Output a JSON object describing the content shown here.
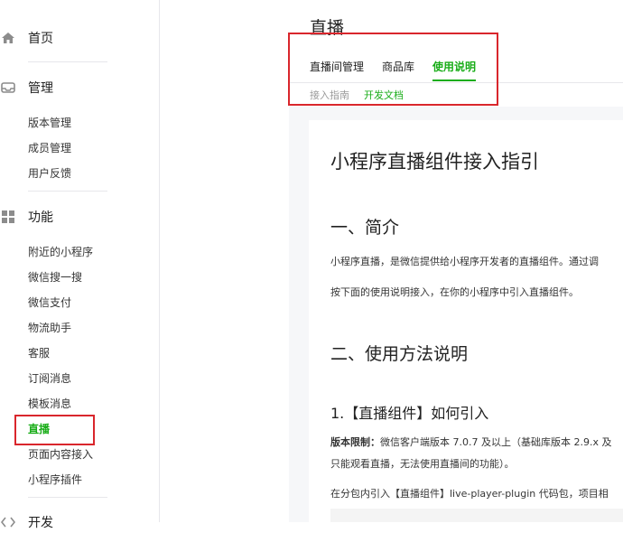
{
  "sidebar": {
    "home": {
      "label": "首页",
      "icon": "home-icon"
    },
    "manage": {
      "label": "管理",
      "icon": "inbox-icon",
      "items": [
        "版本管理",
        "成员管理",
        "用户反馈"
      ]
    },
    "features": {
      "label": "功能",
      "icon": "grid-icon",
      "items": [
        "附近的小程序",
        "微信搜一搜",
        "微信支付",
        "物流助手",
        "客服",
        "订阅消息",
        "模板消息",
        "直播",
        "页面内容接入",
        "小程序插件"
      ],
      "active_index": 7
    },
    "dev": {
      "label": "开发",
      "icon": "code-icon"
    }
  },
  "page": {
    "title": "直播",
    "tabs": [
      "直播间管理",
      "商品库",
      "使用说明"
    ],
    "active_tab": 2,
    "subtabs": [
      "接入指南",
      "开发文档"
    ],
    "active_subtab": 1
  },
  "doc": {
    "title": "小程序直播组件接入指引",
    "section1": "一、简介",
    "p1": "小程序直播，是微信提供给小程序开发者的直播组件。通过调",
    "p2": "按下面的使用说明接入，在你的小程序中引入直播组件。",
    "section2": "二、使用方法说明",
    "sub1": "1.【直播组件】如何引入",
    "limit_label": "版本限制：",
    "limit_text": "微信客户端版本 7.0.7 及以上（基础库版本 2.9.x 及",
    "limit_text2": "只能观看直播，无法使用直播间的功能）。",
    "p3": "在分包内引入【直播组件】live-player-plugin 代码包，项目相"
  },
  "colors": {
    "accent": "#1aad19",
    "highlight": "#d9262c"
  }
}
